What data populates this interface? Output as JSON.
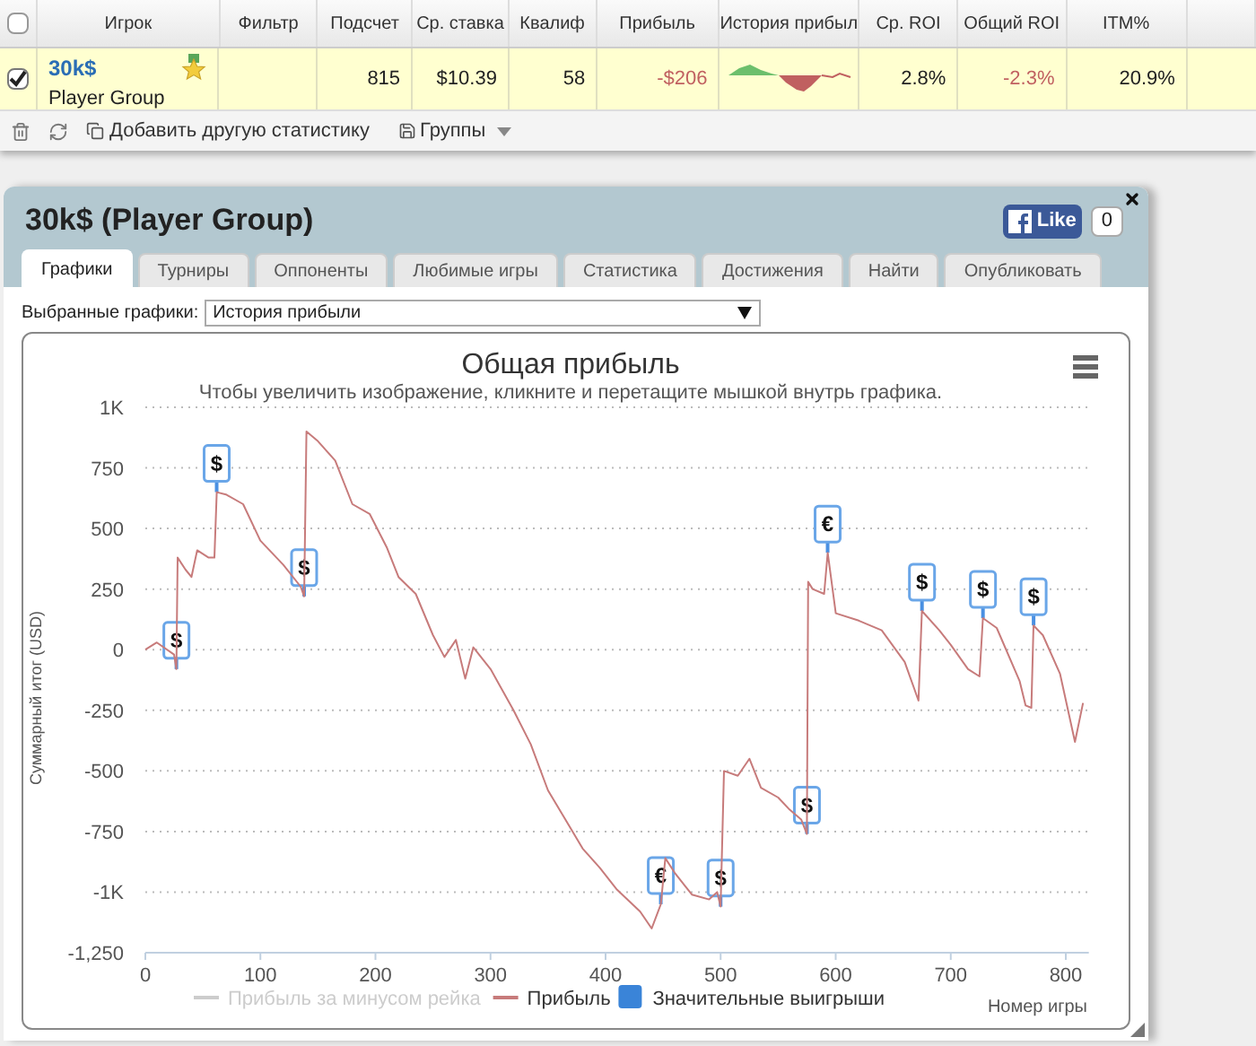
{
  "table": {
    "header_checked": false,
    "columns": [
      "Игрок",
      "Фильтр",
      "Подсчет",
      "Ср. ставка",
      "Квалиф",
      "Прибыль",
      "История прибыл",
      "Ср. ROI",
      "Общий ROI",
      "ITM%",
      ""
    ],
    "rows": [
      {
        "checked": true,
        "name": "30k$",
        "group": "Player Group",
        "filter": "",
        "count": "815",
        "avg_stake": "$10.39",
        "qualif": "58",
        "profit": {
          "text": "-$206",
          "negative": true
        },
        "avg_roi": {
          "text": "2.8%",
          "negative": false
        },
        "total_roi": {
          "text": "-2.3%",
          "negative": true
        },
        "itm": "20.9%"
      }
    ]
  },
  "toolbar": {
    "add_stats": "Добавить другую статистику",
    "groups": "Группы"
  },
  "dialog": {
    "title": "30k$ (Player Group)",
    "like": "Like",
    "like_count": "0",
    "tabs": [
      {
        "label": "Графики",
        "selected": true
      },
      {
        "label": "Турниры",
        "selected": false
      },
      {
        "label": "Оппоненты",
        "selected": false
      },
      {
        "label": "Любимые игры",
        "selected": false
      },
      {
        "label": "Статистика",
        "selected": false
      },
      {
        "label": "Достижения",
        "selected": false
      },
      {
        "label": "Найти",
        "selected": false
      },
      {
        "label": "Опубликовать",
        "selected": false
      }
    ],
    "chart_select": {
      "label": "Выбранные графики:",
      "value": "История прибыли"
    },
    "chart": {
      "subtitle": "Чтобы увеличить изображение, кликните и перетащите мышкой внутрь графика.",
      "legend_hidden_series": {
        "label": "Прибыль за минусом рейка",
        "hidden": true
      },
      "legend_flags": {
        "label": "Значительные выигрыши",
        "color": "#3a84d8"
      },
      "chart_data": {
        "type": "line",
        "title": "Общая прибыль",
        "xlabel": "Номер игры",
        "ylabel": "Суммарный итог (USD)",
        "grid": true,
        "x": [
          0,
          10,
          25,
          27,
          28,
          35,
          40,
          45,
          55,
          60,
          62,
          70,
          85,
          100,
          120,
          135,
          138,
          140,
          150,
          165,
          180,
          195,
          210,
          220,
          235,
          250,
          260,
          270,
          278,
          285,
          300,
          320,
          335,
          350,
          365,
          380,
          395,
          410,
          430,
          440,
          448,
          452,
          460,
          475,
          490,
          497,
          500,
          503,
          515,
          525,
          535,
          550,
          560,
          570,
          575,
          576,
          580,
          590,
          593,
          600,
          620,
          640,
          660,
          672,
          675,
          690,
          700,
          715,
          725,
          728,
          740,
          760,
          765,
          770,
          772,
          780,
          795,
          808,
          815
        ],
        "series": [
          {
            "name": "Прибыль",
            "color": "#c77b7b",
            "values": [
              0,
              30,
              -20,
              -80,
              380,
              330,
              300,
              410,
              380,
              380,
              650,
              640,
              600,
              450,
              350,
              260,
              220,
              900,
              860,
              780,
              600,
              560,
              420,
              300,
              230,
              60,
              -30,
              40,
              -120,
              10,
              -80,
              -250,
              -390,
              -580,
              -700,
              -820,
              -900,
              -990,
              -1080,
              -1150,
              -1050,
              -860,
              -920,
              -1010,
              -1030,
              -1000,
              -1060,
              -500,
              -520,
              -450,
              -570,
              -610,
              -660,
              -700,
              -760,
              280,
              250,
              230,
              400,
              150,
              120,
              80,
              -50,
              -210,
              160,
              80,
              20,
              -80,
              -110,
              130,
              90,
              -130,
              -230,
              -240,
              100,
              60,
              -100,
              -380,
              -220
            ]
          }
        ],
        "xlim": [
          0,
          820
        ],
        "ylim": [
          -1250,
          1000
        ],
        "xticks": [
          0,
          100,
          200,
          300,
          400,
          500,
          600,
          700,
          800
        ],
        "yticks": [
          {
            "value": -1250,
            "label": "-1,250"
          },
          {
            "value": -1000,
            "label": "-1K"
          },
          -750,
          -500,
          -250,
          0,
          250,
          500,
          750,
          {
            "value": 1000,
            "label": "1K"
          }
        ],
        "annotations": [
          {
            "x": 27,
            "y": -80,
            "text": "$"
          },
          {
            "x": 62,
            "y": 650,
            "text": "$"
          },
          {
            "x": 138,
            "y": 220,
            "text": "$"
          },
          {
            "x": 448,
            "y": -1050,
            "text": "€"
          },
          {
            "x": 500,
            "y": -1060,
            "text": "$"
          },
          {
            "x": 575,
            "y": -760,
            "text": "$"
          },
          {
            "x": 593,
            "y": 400,
            "text": "€"
          },
          {
            "x": 675,
            "y": 160,
            "text": "$"
          },
          {
            "x": 728,
            "y": 130,
            "text": "$"
          },
          {
            "x": 772,
            "y": 100,
            "text": "$"
          }
        ]
      }
    }
  }
}
